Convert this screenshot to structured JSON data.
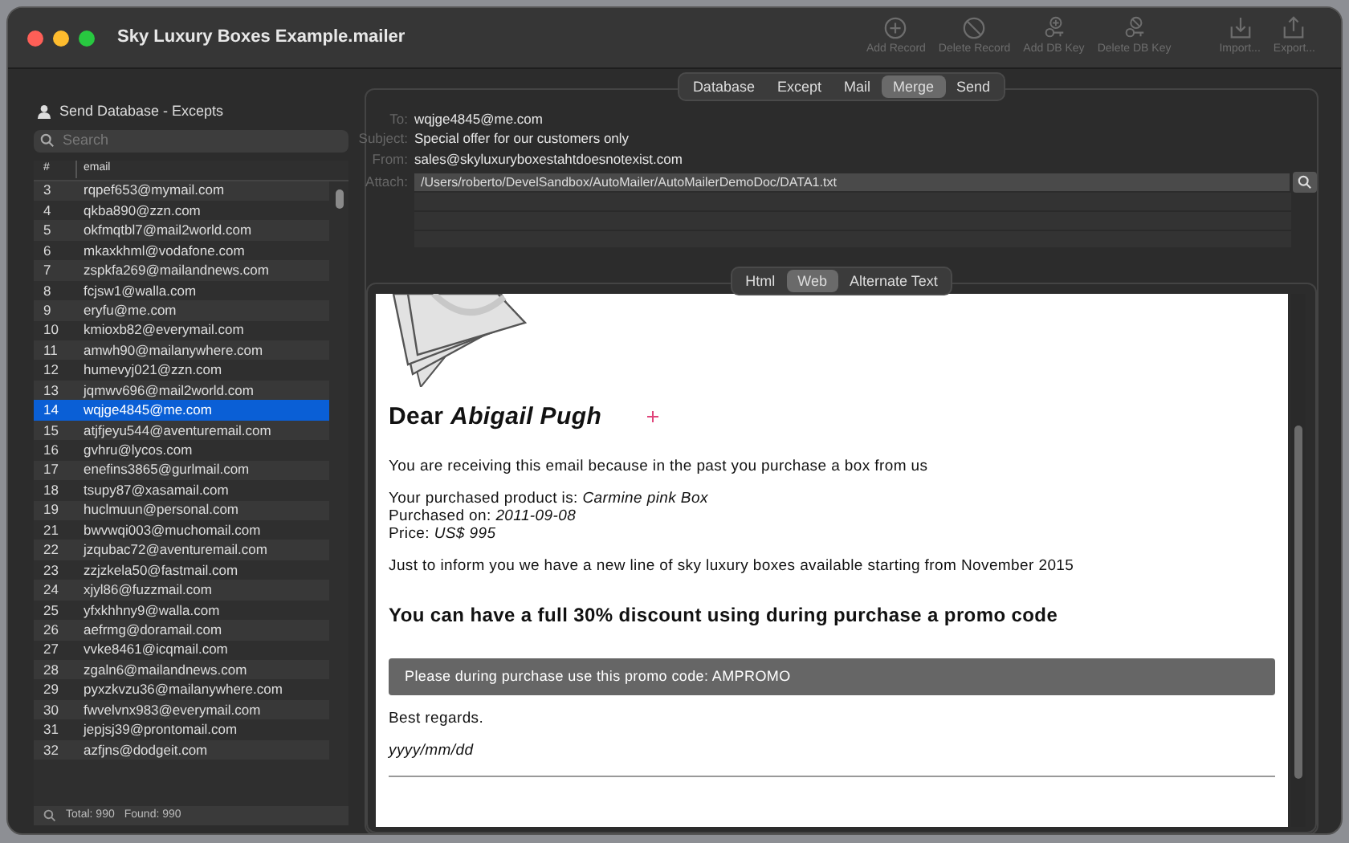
{
  "window": {
    "title": "Sky Luxury Boxes Example.mailer"
  },
  "toolbar": [
    {
      "kind": "add",
      "label": "Add Record"
    },
    {
      "kind": "delete",
      "label": "Delete Record"
    },
    {
      "kind": "addkey",
      "label": "Add DB Key"
    },
    {
      "kind": "delkey",
      "label": "Delete DB Key"
    },
    {
      "kind": "import",
      "label": "Import..."
    },
    {
      "kind": "export",
      "label": "Export..."
    }
  ],
  "tabs": [
    {
      "label": "Database",
      "selected": false
    },
    {
      "label": "Except",
      "selected": false
    },
    {
      "label": "Mail",
      "selected": false
    },
    {
      "label": "Merge",
      "selected": true
    },
    {
      "label": "Send",
      "selected": false
    }
  ],
  "sidebar": {
    "title": "Send Database - Excepts",
    "search": {
      "placeholder": "Search"
    },
    "columns": [
      "#",
      "email"
    ],
    "rows": [
      {
        "num": "3",
        "email": "rqpef653@mymail.com",
        "selected": false
      },
      {
        "num": "4",
        "email": "qkba890@zzn.com",
        "selected": false
      },
      {
        "num": "5",
        "email": "okfmqtbl7@mail2world.com",
        "selected": false
      },
      {
        "num": "6",
        "email": "mkaxkhml@vodafone.com",
        "selected": false
      },
      {
        "num": "7",
        "email": "zspkfa269@mailandnews.com",
        "selected": false
      },
      {
        "num": "8",
        "email": "fcjsw1@walla.com",
        "selected": false
      },
      {
        "num": "9",
        "email": "eryfu@me.com",
        "selected": false
      },
      {
        "num": "10",
        "email": "kmioxb82@everymail.com",
        "selected": false
      },
      {
        "num": "11",
        "email": "amwh90@mailanywhere.com",
        "selected": false
      },
      {
        "num": "12",
        "email": "humevyj021@zzn.com",
        "selected": false
      },
      {
        "num": "13",
        "email": "jqmwv696@mail2world.com",
        "selected": false
      },
      {
        "num": "14",
        "email": "wqjge4845@me.com",
        "selected": true
      },
      {
        "num": "15",
        "email": "atjfjeyu544@aventuremail.com",
        "selected": false
      },
      {
        "num": "16",
        "email": "gvhru@lycos.com",
        "selected": false
      },
      {
        "num": "17",
        "email": "enefins3865@gurlmail.com",
        "selected": false
      },
      {
        "num": "18",
        "email": "tsupy87@xasamail.com",
        "selected": false
      },
      {
        "num": "19",
        "email": "huclmuun@personal.com",
        "selected": false
      },
      {
        "num": "21",
        "email": "bwvwqi003@muchomail.com",
        "selected": false
      },
      {
        "num": "22",
        "email": "jzqubac72@aventuremail.com",
        "selected": false
      },
      {
        "num": "23",
        "email": "zzjzkela50@fastmail.com",
        "selected": false
      },
      {
        "num": "24",
        "email": "xjyl86@fuzzmail.com",
        "selected": false
      },
      {
        "num": "25",
        "email": "yfxkhhny9@walla.com",
        "selected": false
      },
      {
        "num": "26",
        "email": "aefrmg@doramail.com",
        "selected": false
      },
      {
        "num": "27",
        "email": "vvke8461@icqmail.com",
        "selected": false
      },
      {
        "num": "28",
        "email": "zgaln6@mailandnews.com",
        "selected": false
      },
      {
        "num": "29",
        "email": "pyxzkvzu36@mailanywhere.com",
        "selected": false
      },
      {
        "num": "30",
        "email": "fwvelvnx983@everymail.com",
        "selected": false
      },
      {
        "num": "31",
        "email": "jepjsj39@prontomail.com",
        "selected": false
      },
      {
        "num": "32",
        "email": "azfjns@dodgeit.com",
        "selected": false
      }
    ],
    "status": {
      "total": "Total: 990",
      "found": "Found: 990"
    }
  },
  "merge": {
    "fields": [
      {
        "label": "To:",
        "value": "wqjge4845@me.com"
      },
      {
        "label": "Subject:",
        "value": "Special offer for our customers only"
      },
      {
        "label": "From:",
        "value": "sales@skyluxuryboxestahtdoesnotexist.com"
      }
    ],
    "attach": {
      "label": "Attach:",
      "value": "/Users/roberto/DevelSandbox/AutoMailer/AutoMailerDemoDoc/DATA1.txt"
    }
  },
  "view_tabs": [
    {
      "label": "Html",
      "selected": false
    },
    {
      "label": "Web",
      "selected": true
    },
    {
      "label": "Alternate Text",
      "selected": false
    }
  ],
  "email": {
    "greeting": "Dear *Abigail Pugh*",
    "intro": "You are receiving this email because in the past you purchase a box from us",
    "details": [
      "Your purchased product is: *Carmine pink Box*",
      "Purchased on: *2011-09-08*",
      "Price: *US$ 995*"
    ],
    "news": "Just to inform you we have a new line of sky luxury boxes available starting from November 2015",
    "headline": "You can have a full 30% discount using during purchase a promo code",
    "promo": "Please during purchase use this promo code: AMPROMO",
    "closing": "Best regards.",
    "date": "yyyy/mm/dd"
  }
}
